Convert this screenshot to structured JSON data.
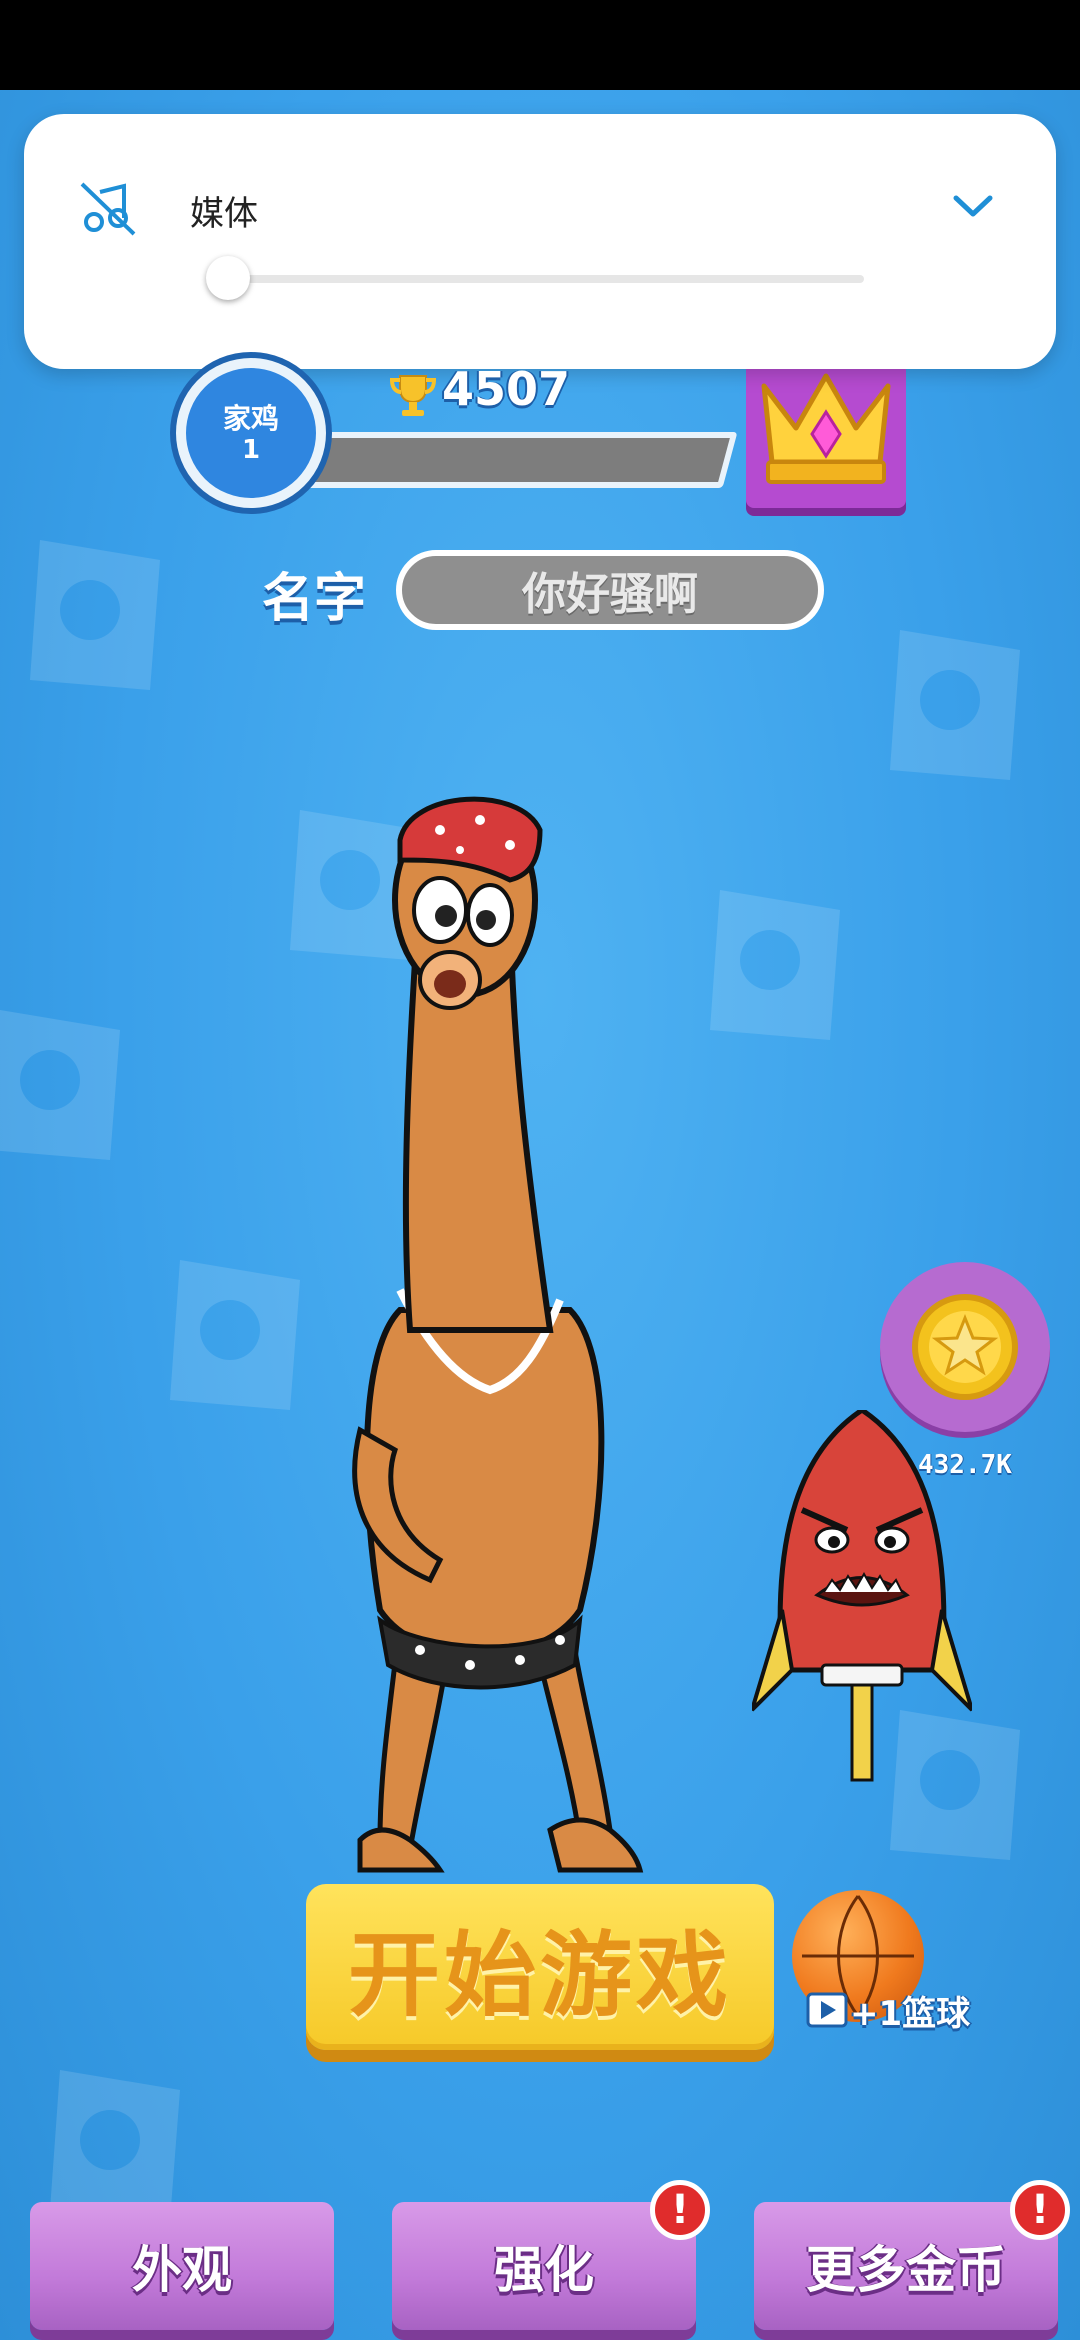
{
  "volume_panel": {
    "label": "媒体",
    "icon": "music-off-icon",
    "level_fraction": 0.0
  },
  "header": {
    "level_name": "家鸡",
    "level_number": "1",
    "trophies": "4507",
    "trophy_icon": "trophy-icon",
    "crown_icon": "crown-icon"
  },
  "name_row": {
    "label": "名字",
    "value": "你好骚啊"
  },
  "coins": {
    "amount": "432.7K",
    "icon": "coin-icon"
  },
  "start": {
    "label": "开始游戏"
  },
  "reward": {
    "label": "+1篮球",
    "icon": "video-play-icon"
  },
  "bottom": {
    "appearance": "外观",
    "upgrade": "强化",
    "more_coins": "更多金币",
    "alert": "!"
  },
  "colors": {
    "background": "#3aa0ea",
    "start_button": "#f6c928",
    "bottom_button": "#c27ad9",
    "alert": "#e02c2c"
  }
}
